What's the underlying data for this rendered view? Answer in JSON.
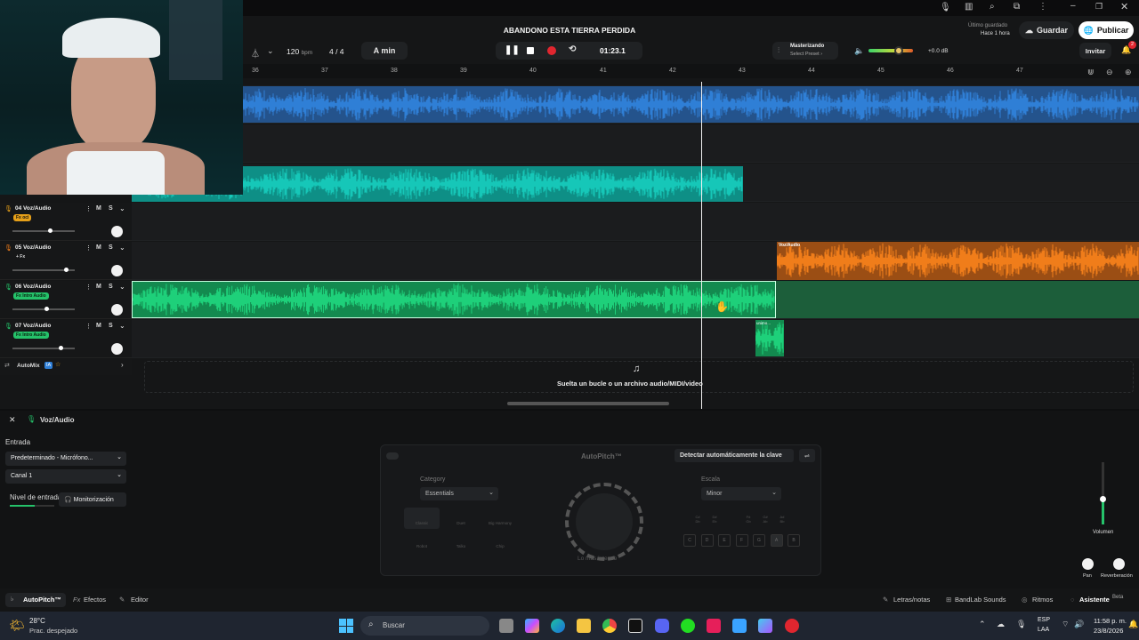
{
  "project": {
    "title": "ABANDONO ESTA TIERRA PERDIDA"
  },
  "transport": {
    "bpm_value": "120",
    "bpm_unit": "bpm",
    "time_sig": "4 / 4",
    "key": "A min",
    "time": "01:23.1"
  },
  "header_right": {
    "saved_label": "Último guardado",
    "saved_time": "Hace 1 hora",
    "save_button": "Guardar",
    "publish_button": "Publicar",
    "invite_button": "Invitar",
    "notif_count": "2",
    "mastering_title": "Masterizando",
    "mastering_preset": "Select Preset ›",
    "volume_db": "+0.0 dB"
  },
  "ruler": [
    "36",
    "37",
    "38",
    "39",
    "40",
    "41",
    "42",
    "43",
    "44",
    "45",
    "46",
    "47"
  ],
  "tracks": [
    {
      "name": "04 Voz/Audio",
      "badge": "Fx oci",
      "badge_color": "#e6a019"
    },
    {
      "name": "05 Voz/Audio",
      "badge": "+ Fx",
      "badge_color": ""
    },
    {
      "name": "06 Voz/Audio",
      "badge": "Fx Intro Audio",
      "badge_color": "#25c26a"
    },
    {
      "name": "07 Voz/Audio",
      "badge": "Fx Intro Audio",
      "badge_color": "#25c26a"
    }
  ],
  "mute_label": "M",
  "solo_label": "S",
  "clips": {
    "orange_label": "Voz/Audio",
    "green_small_label": "unimo..."
  },
  "automix": {
    "label": "AutoMix",
    "badge": "IA"
  },
  "dropzone": {
    "text": "Suelta un bucle o un archivo audio/MIDI/video"
  },
  "panel": {
    "track_name": "Voz/Audio",
    "input_label": "Entrada",
    "input_device": "Predeterminado - Micrófono...",
    "channel": "Canal 1",
    "level_label": "Nivel de entrada",
    "monitor_button": "Monitorización",
    "autopitch_title": "AutoPitch™",
    "detect_key_button": "Detectar automáticamente la clave",
    "category_label": "Category",
    "category_value": "Essentials",
    "scale_label": "Escala",
    "scale_value": "Minor",
    "presets": [
      "Classic",
      "Duet",
      "Big Harmony",
      "Robot",
      "Talko",
      "Chip"
    ],
    "knob_caption": "Lo más intenso",
    "notes": [
      "C",
      "D",
      "E",
      "F",
      "G",
      "A",
      "B"
    ],
    "sharps": [
      "C#\nDb",
      "D#\nEb",
      "F#\nGb",
      "G#\nAb",
      "A#\nBb"
    ],
    "volume_label": "Volumen",
    "pan_label": "Pan",
    "reverb_label": "Reverberación"
  },
  "footer_tabs": {
    "autopitch": "AutoPitch™",
    "effects": "Efectos",
    "editor": "Editor",
    "lyrics": "Letras/notas",
    "sounds": "BandLab Sounds",
    "rhythms": "Ritmos",
    "assistant": "Asistente",
    "beta": "Beta"
  },
  "taskbar": {
    "temp": "28°C",
    "weather": "Prac. despejado",
    "search_placeholder": "Buscar",
    "lang_top": "ESP",
    "lang_bottom": "LAA",
    "clock_time": "11:58 p. m.",
    "clock_date": "23/8/2026"
  },
  "colors": {
    "blue_track": "#2f7fd6",
    "cyan_track": "#16c7b8",
    "green_track": "#1ed07a",
    "orange_track": "#f07d1a",
    "accent_red": "#e0262f"
  }
}
